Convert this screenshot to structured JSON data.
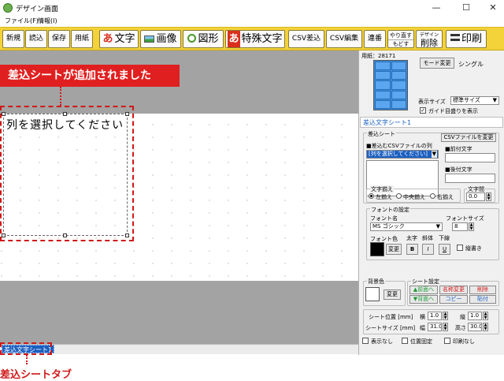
{
  "window": {
    "title": "デザイン画面",
    "minimize": "—",
    "maximize": "☐",
    "close": "✕"
  },
  "menu": [
    "ファイル(F)",
    "情報(I)"
  ],
  "toolbar": {
    "new": "新規",
    "load": "読込",
    "save": "保存",
    "paper": "用紙",
    "text_icon": "あ",
    "text": "文字",
    "image": "画像",
    "shape": "図形",
    "special_icon": "あ",
    "special": "特殊文字",
    "csv_insert": "CSV差込",
    "csv_edit": "CSV編集",
    "serial": "連番",
    "redo": "やり直す",
    "undo": "もどす",
    "design": "デザイン",
    "delete": "削除",
    "print": "印刷"
  },
  "canvas": {
    "frame_text": "列を選択してください"
  },
  "callouts": {
    "added": "差込シートが追加されました",
    "tab": "差込シートタブ"
  },
  "tabs": [
    "差込文字シート1"
  ],
  "panel": {
    "paper_label": "用紙：",
    "paper_code": "28171",
    "mode_button": "モード変更",
    "mode_value": "シングル",
    "display_size_label": "表示サイズ",
    "display_size_value": "標準サイズ",
    "guide_label": "ガイド目盛りを表示",
    "sheet_title": "差込文字シート1",
    "insert_sheet_label": "差込シート",
    "csv_file_button": "CSVファイルを変更",
    "csv_column_label": "■差込むCSVファイルの列",
    "column_select": "[列を選択してください]",
    "prefix_label": "■前付文字",
    "suffix_label": "■後付文字",
    "align_group": "文字揃え",
    "align_left": "左揃え",
    "align_center": "中央揃え",
    "align_right": "右揃え",
    "spacing_label": "文字間",
    "spacing_value": "0.0",
    "font_group": "フォントの設定",
    "font_name_label": "フォント名",
    "font_name_value": "MS ゴシック",
    "font_size_label": "フォントサイズ",
    "font_size_value": "8",
    "font_color_label": "フォント色",
    "bold_label": "太字",
    "italic_label": "斜体",
    "underline_label": "下線",
    "color_change": "変更",
    "bold": "B",
    "italic": "I",
    "underline": "U",
    "vertical_label": "縦書き",
    "bg_color_label": "背景色",
    "bg_change": "変更",
    "sheet_settings_label": "シート設定",
    "front": "▲前面へ",
    "back": "▼背面へ",
    "rename": "名称変更",
    "copy": "コピー",
    "remove": "削除",
    "paste": "貼付",
    "pos_label": "シート位置 [mm]",
    "pos_x_label": "横",
    "pos_x_value": "1.0",
    "pos_y_label": "縦",
    "pos_y_value": "1.0",
    "size_label": "シートサイズ [mm]",
    "width_label": "幅",
    "width_value": "31.0",
    "height_label": "高さ",
    "height_value": "30.0",
    "hide_label": "表示なし",
    "lock_label": "位置固定",
    "noprint_label": "印刷なし"
  },
  "colors": {
    "toolbar": "#f3d23a",
    "callout": "#e02020",
    "tab_active": "#1b5fc1",
    "text_icon": "#d9301e",
    "image_icon": "#3f9f3f",
    "shape_icon": "#4a9a2a",
    "sheet_front": "#1f9a3a",
    "sheet_rename": "#d41a1a"
  }
}
